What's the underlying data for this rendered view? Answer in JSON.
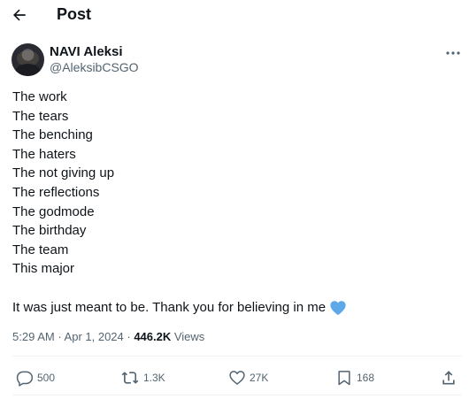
{
  "header": {
    "title": "Post",
    "back_icon": "arrow-left-icon"
  },
  "author": {
    "display_name": "NAVI Aleksi",
    "handle": "@AleksibCSGO"
  },
  "tweet": {
    "lines": [
      "The work",
      "The tears",
      "The benching",
      "The haters",
      "The not giving up",
      "The reflections",
      "The godmode",
      "The birthday",
      "The team",
      "This major"
    ],
    "closing": "It was just meant to be. Thank you for believing in me",
    "emoji_icon": "blue-heart-icon"
  },
  "meta": {
    "time": "5:29 AM",
    "separator": " · ",
    "date": "Apr 1, 2024",
    "views_count": "446.2K",
    "views_label": " Views"
  },
  "actions": {
    "replies": "500",
    "reposts": "1.3K",
    "likes": "27K",
    "bookmarks": "168"
  },
  "colors": {
    "text": "#0f1419",
    "secondary": "#536471",
    "divider": "#eff3f4",
    "heart_emoji": "#5da8e8"
  }
}
